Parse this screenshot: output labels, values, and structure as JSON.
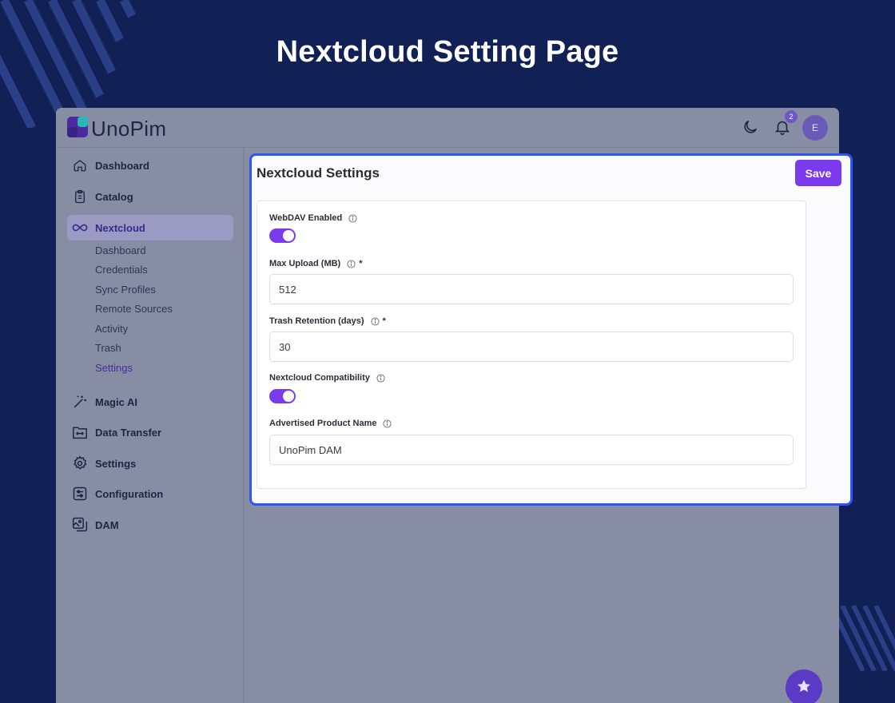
{
  "page": {
    "heading": "Nextcloud Setting Page"
  },
  "app": {
    "logo_text": "UnoPim",
    "notifications_count": "2",
    "avatar_initial": "E"
  },
  "sidebar": {
    "items": [
      {
        "label": "Dashboard",
        "icon": "home-icon"
      },
      {
        "label": "Catalog",
        "icon": "clipboard-icon"
      },
      {
        "label": "Nextcloud",
        "icon": "infinity-icon"
      },
      {
        "label": "Magic AI",
        "icon": "magic-wand-icon"
      },
      {
        "label": "Data Transfer",
        "icon": "folder-transfer-icon"
      },
      {
        "label": "Settings",
        "icon": "gear-icon"
      },
      {
        "label": "Configuration",
        "icon": "sliders-icon"
      },
      {
        "label": "DAM",
        "icon": "images-icon"
      }
    ],
    "nextcloud_sub": [
      "Dashboard",
      "Credentials",
      "Sync Profiles",
      "Remote Sources",
      "Activity",
      "Trash",
      "Settings"
    ]
  },
  "panel": {
    "title": "Nextcloud Settings",
    "save_label": "Save",
    "fields": {
      "webdav_label": "WebDAV Enabled",
      "webdav_enabled": true,
      "max_upload_label": "Max Upload (MB)",
      "max_upload_value": "512",
      "trash_label": "Trash Retention (days)",
      "trash_value": "30",
      "compat_label": "Nextcloud Compatibility",
      "compat_enabled": true,
      "product_label": "Advertised Product Name",
      "product_value": "UnoPim DAM",
      "required_mark": "*"
    }
  },
  "colors": {
    "background": "#112055",
    "accent": "#7c3aed",
    "highlight_border": "#2f55f5"
  }
}
